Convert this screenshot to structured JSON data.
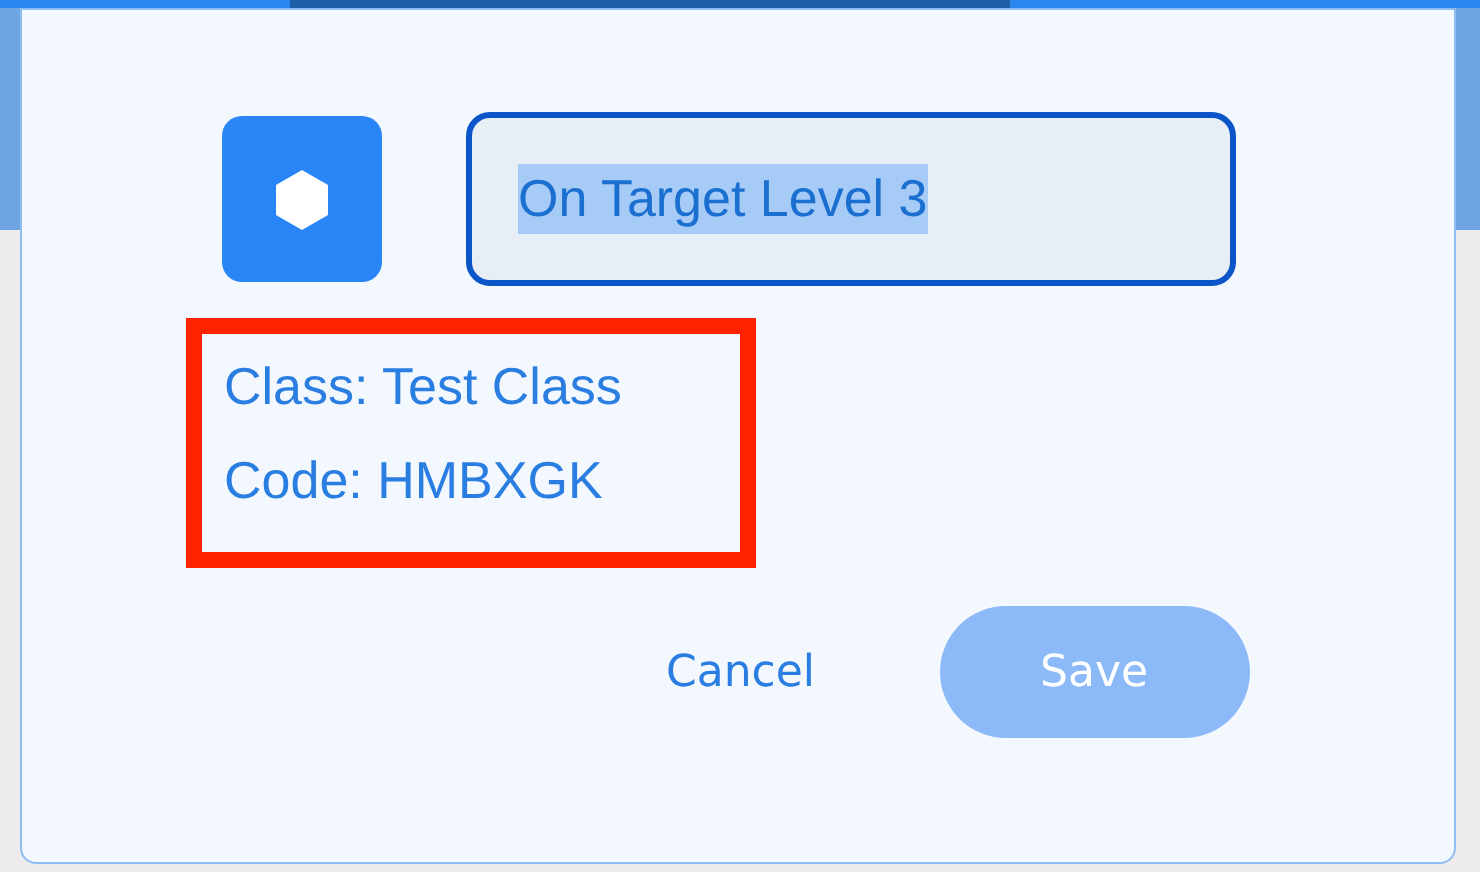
{
  "icon_button": {
    "kind": "hexagon"
  },
  "name_field": {
    "value": "On Target Level 3",
    "text_selected": true
  },
  "details": {
    "highlighted": true,
    "lines": [
      "Class: Test Class",
      "Code: HMBXGK"
    ]
  },
  "buttons": [
    {
      "label": "Cancel",
      "kind": "text",
      "disabled": false
    },
    {
      "label": "Save",
      "kind": "filled",
      "disabled": true
    }
  ]
}
